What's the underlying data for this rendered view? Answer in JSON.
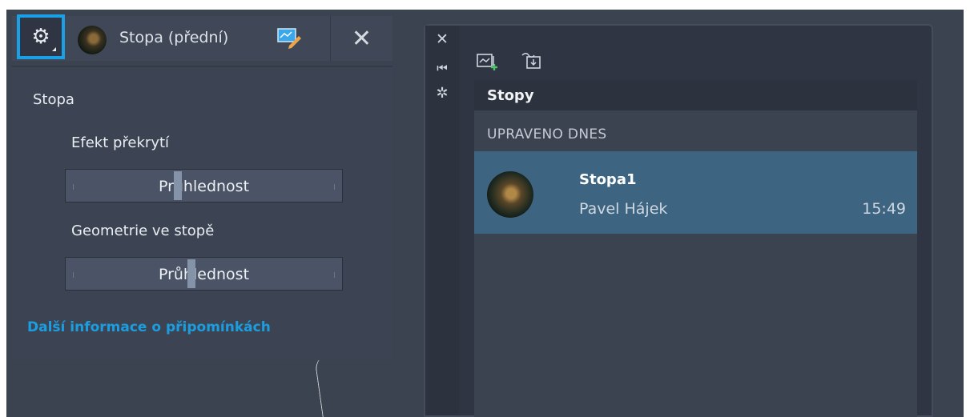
{
  "markup_bar": {
    "title": "Stopa (přední)",
    "settings_icon": "gear-icon",
    "edit_icon": "markup-edit-icon",
    "close_icon": "close-icon"
  },
  "settings_panel": {
    "section_title": "Stopa",
    "overlay_effect_label": "Efekt překrytí",
    "overlay_slider": {
      "text": "Průhlednost",
      "value_fraction": 0.4
    },
    "geometry_label": "Geometrie ve stopě",
    "geometry_slider": {
      "text": "Průhlednost",
      "value_fraction": 0.45
    },
    "more_info_link": "Další informace o připomínkách"
  },
  "traces_panel": {
    "side_icons": [
      "close-icon",
      "dock-icon",
      "gear-icon"
    ],
    "toolbar_icons": [
      "new-trace-icon",
      "import-trace-icon"
    ],
    "header": "Stopy",
    "group_label": "UPRAVENO DNES",
    "items": [
      {
        "title": "Stopa1",
        "author": "Pavel Hájek",
        "time": "15:49"
      }
    ]
  },
  "colors": {
    "accent": "#1aa0e6",
    "selected_row": "#3d6581",
    "canvas": "#3b4250"
  }
}
